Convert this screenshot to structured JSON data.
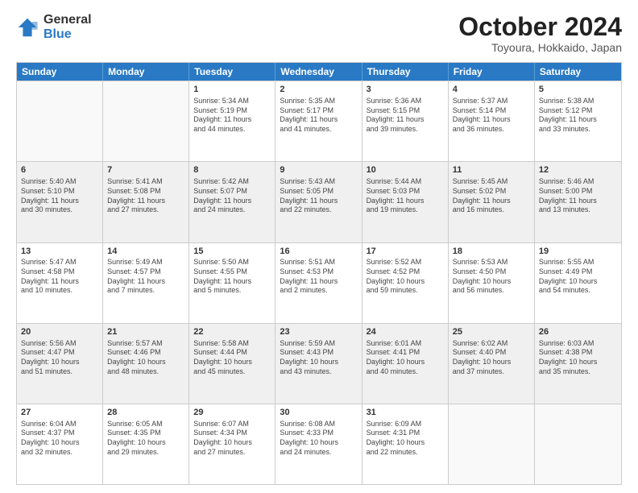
{
  "header": {
    "logo_general": "General",
    "logo_blue": "Blue",
    "month": "October 2024",
    "location": "Toyoura, Hokkaido, Japan"
  },
  "weekdays": [
    "Sunday",
    "Monday",
    "Tuesday",
    "Wednesday",
    "Thursday",
    "Friday",
    "Saturday"
  ],
  "weeks": [
    [
      {
        "day": "",
        "lines": [],
        "empty": true
      },
      {
        "day": "",
        "lines": [],
        "empty": true
      },
      {
        "day": "1",
        "lines": [
          "Sunrise: 5:34 AM",
          "Sunset: 5:19 PM",
          "Daylight: 11 hours",
          "and 44 minutes."
        ]
      },
      {
        "day": "2",
        "lines": [
          "Sunrise: 5:35 AM",
          "Sunset: 5:17 PM",
          "Daylight: 11 hours",
          "and 41 minutes."
        ]
      },
      {
        "day": "3",
        "lines": [
          "Sunrise: 5:36 AM",
          "Sunset: 5:15 PM",
          "Daylight: 11 hours",
          "and 39 minutes."
        ]
      },
      {
        "day": "4",
        "lines": [
          "Sunrise: 5:37 AM",
          "Sunset: 5:14 PM",
          "Daylight: 11 hours",
          "and 36 minutes."
        ]
      },
      {
        "day": "5",
        "lines": [
          "Sunrise: 5:38 AM",
          "Sunset: 5:12 PM",
          "Daylight: 11 hours",
          "and 33 minutes."
        ]
      }
    ],
    [
      {
        "day": "6",
        "lines": [
          "Sunrise: 5:40 AM",
          "Sunset: 5:10 PM",
          "Daylight: 11 hours",
          "and 30 minutes."
        ],
        "shaded": true
      },
      {
        "day": "7",
        "lines": [
          "Sunrise: 5:41 AM",
          "Sunset: 5:08 PM",
          "Daylight: 11 hours",
          "and 27 minutes."
        ],
        "shaded": true
      },
      {
        "day": "8",
        "lines": [
          "Sunrise: 5:42 AM",
          "Sunset: 5:07 PM",
          "Daylight: 11 hours",
          "and 24 minutes."
        ],
        "shaded": true
      },
      {
        "day": "9",
        "lines": [
          "Sunrise: 5:43 AM",
          "Sunset: 5:05 PM",
          "Daylight: 11 hours",
          "and 22 minutes."
        ],
        "shaded": true
      },
      {
        "day": "10",
        "lines": [
          "Sunrise: 5:44 AM",
          "Sunset: 5:03 PM",
          "Daylight: 11 hours",
          "and 19 minutes."
        ],
        "shaded": true
      },
      {
        "day": "11",
        "lines": [
          "Sunrise: 5:45 AM",
          "Sunset: 5:02 PM",
          "Daylight: 11 hours",
          "and 16 minutes."
        ],
        "shaded": true
      },
      {
        "day": "12",
        "lines": [
          "Sunrise: 5:46 AM",
          "Sunset: 5:00 PM",
          "Daylight: 11 hours",
          "and 13 minutes."
        ],
        "shaded": true
      }
    ],
    [
      {
        "day": "13",
        "lines": [
          "Sunrise: 5:47 AM",
          "Sunset: 4:58 PM",
          "Daylight: 11 hours",
          "and 10 minutes."
        ]
      },
      {
        "day": "14",
        "lines": [
          "Sunrise: 5:49 AM",
          "Sunset: 4:57 PM",
          "Daylight: 11 hours",
          "and 7 minutes."
        ]
      },
      {
        "day": "15",
        "lines": [
          "Sunrise: 5:50 AM",
          "Sunset: 4:55 PM",
          "Daylight: 11 hours",
          "and 5 minutes."
        ]
      },
      {
        "day": "16",
        "lines": [
          "Sunrise: 5:51 AM",
          "Sunset: 4:53 PM",
          "Daylight: 11 hours",
          "and 2 minutes."
        ]
      },
      {
        "day": "17",
        "lines": [
          "Sunrise: 5:52 AM",
          "Sunset: 4:52 PM",
          "Daylight: 10 hours",
          "and 59 minutes."
        ]
      },
      {
        "day": "18",
        "lines": [
          "Sunrise: 5:53 AM",
          "Sunset: 4:50 PM",
          "Daylight: 10 hours",
          "and 56 minutes."
        ]
      },
      {
        "day": "19",
        "lines": [
          "Sunrise: 5:55 AM",
          "Sunset: 4:49 PM",
          "Daylight: 10 hours",
          "and 54 minutes."
        ]
      }
    ],
    [
      {
        "day": "20",
        "lines": [
          "Sunrise: 5:56 AM",
          "Sunset: 4:47 PM",
          "Daylight: 10 hours",
          "and 51 minutes."
        ],
        "shaded": true
      },
      {
        "day": "21",
        "lines": [
          "Sunrise: 5:57 AM",
          "Sunset: 4:46 PM",
          "Daylight: 10 hours",
          "and 48 minutes."
        ],
        "shaded": true
      },
      {
        "day": "22",
        "lines": [
          "Sunrise: 5:58 AM",
          "Sunset: 4:44 PM",
          "Daylight: 10 hours",
          "and 45 minutes."
        ],
        "shaded": true
      },
      {
        "day": "23",
        "lines": [
          "Sunrise: 5:59 AM",
          "Sunset: 4:43 PM",
          "Daylight: 10 hours",
          "and 43 minutes."
        ],
        "shaded": true
      },
      {
        "day": "24",
        "lines": [
          "Sunrise: 6:01 AM",
          "Sunset: 4:41 PM",
          "Daylight: 10 hours",
          "and 40 minutes."
        ],
        "shaded": true
      },
      {
        "day": "25",
        "lines": [
          "Sunrise: 6:02 AM",
          "Sunset: 4:40 PM",
          "Daylight: 10 hours",
          "and 37 minutes."
        ],
        "shaded": true
      },
      {
        "day": "26",
        "lines": [
          "Sunrise: 6:03 AM",
          "Sunset: 4:38 PM",
          "Daylight: 10 hours",
          "and 35 minutes."
        ],
        "shaded": true
      }
    ],
    [
      {
        "day": "27",
        "lines": [
          "Sunrise: 6:04 AM",
          "Sunset: 4:37 PM",
          "Daylight: 10 hours",
          "and 32 minutes."
        ]
      },
      {
        "day": "28",
        "lines": [
          "Sunrise: 6:05 AM",
          "Sunset: 4:35 PM",
          "Daylight: 10 hours",
          "and 29 minutes."
        ]
      },
      {
        "day": "29",
        "lines": [
          "Sunrise: 6:07 AM",
          "Sunset: 4:34 PM",
          "Daylight: 10 hours",
          "and 27 minutes."
        ]
      },
      {
        "day": "30",
        "lines": [
          "Sunrise: 6:08 AM",
          "Sunset: 4:33 PM",
          "Daylight: 10 hours",
          "and 24 minutes."
        ]
      },
      {
        "day": "31",
        "lines": [
          "Sunrise: 6:09 AM",
          "Sunset: 4:31 PM",
          "Daylight: 10 hours",
          "and 22 minutes."
        ]
      },
      {
        "day": "",
        "lines": [],
        "empty": true
      },
      {
        "day": "",
        "lines": [],
        "empty": true
      }
    ]
  ]
}
